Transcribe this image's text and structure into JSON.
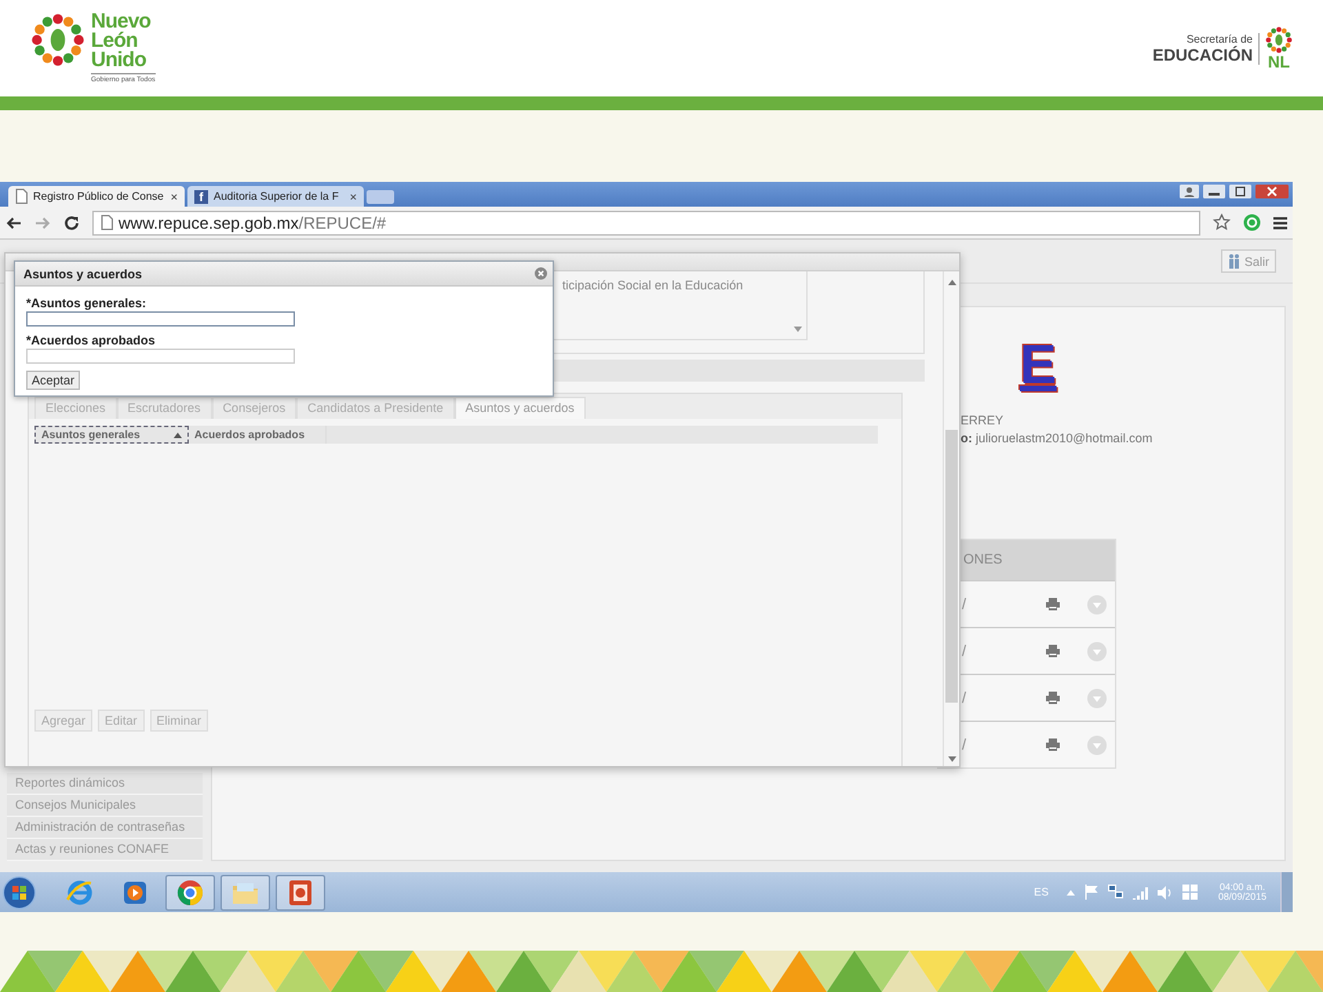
{
  "header": {
    "logo_left": {
      "words": [
        "Nuevo",
        "León",
        "Unido"
      ],
      "tagline": "Gobierno para Todos"
    },
    "logo_right": {
      "line_1": "Secretaría de",
      "line_2": "EDUCACIÓN",
      "mark": "NL"
    }
  },
  "browser": {
    "tabs": [
      {
        "kind": "page",
        "title": "Registro Público de Conse",
        "close": "×",
        "selected": true
      },
      {
        "kind": "social",
        "icon_text": "f",
        "title": "Auditoria Superior de la F",
        "close": "×",
        "selected": false
      }
    ],
    "url_host": "www.repuce.sep.gob.mx",
    "url_path": "/REPUCE/#"
  },
  "page": {
    "logout_button": "Salir",
    "sidebar": {
      "items": [
        "Reportes dinámicos",
        "Consejos Municipales",
        "Administración de contraseñas",
        "Actas y reuniones CONAFE"
      ]
    },
    "profile": {
      "logo_letter": "E",
      "line_1": "ERREY",
      "line_2": "**o:** julioruelastm2010@hotmail.com"
    },
    "actions_table": {
      "header": "ONES",
      "rows": [
        {
          "cell_1": "/"
        },
        {
          "cell_1": "/"
        },
        {
          "cell_1": "/"
        },
        {
          "cell_1": "/"
        }
      ]
    }
  },
  "form_dialog": {
    "description": "ticipación Social en la Educación",
    "tabs": [
      {
        "label": "Elecciones",
        "selected": false
      },
      {
        "label": "Escrutadores",
        "selected": false
      },
      {
        "label": "Consejeros",
        "selected": false
      },
      {
        "label": "Candidatos a Presidente",
        "selected": false
      },
      {
        "label": "Asuntos y acuerdos",
        "selected": true
      }
    ],
    "grid": {
      "columns": [
        {
          "label": "Asuntos generales",
          "sorted": true
        },
        {
          "label": "Acuerdos aprobados",
          "sorted": false
        }
      ]
    },
    "buttons": [
      "Agregar",
      "Editar",
      "Eliminar"
    ]
  },
  "modal": {
    "title": "Asuntos y acuerdos",
    "fields": [
      {
        "label": "*Asuntos generales:",
        "focused": true
      },
      {
        "label": "*Acuerdos aprobados",
        "focused": false
      }
    ],
    "button": "Aceptar"
  },
  "taskbar": {
    "apps": [
      {
        "kind": "ie",
        "running": false
      },
      {
        "kind": "media",
        "running": false
      },
      {
        "kind": "chrome",
        "running": true
      },
      {
        "kind": "folder",
        "running": true
      },
      {
        "kind": "slides",
        "running": true
      }
    ],
    "language": "ES",
    "time": "04:00 a.m.",
    "date": "08/09/2015"
  }
}
